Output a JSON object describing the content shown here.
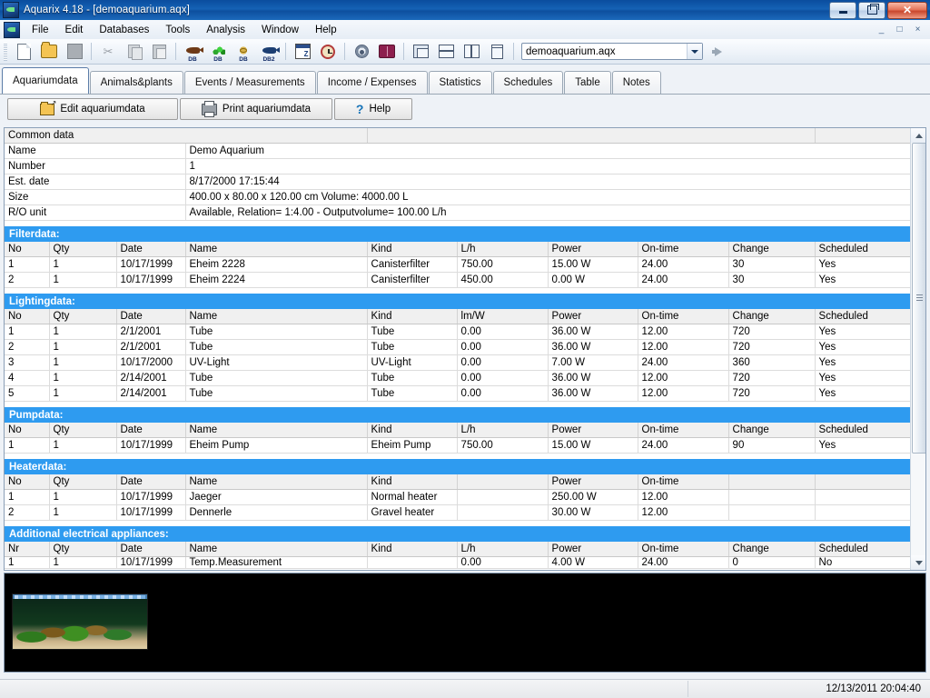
{
  "window": {
    "title": "Aquarix 4.18  - [demoaquarium.aqx]",
    "app_icon": "aquarium-fish-icon",
    "minimize_label": "Minimize",
    "restore_label": "Restore",
    "close_label": "Close",
    "mdi_minimize": "_",
    "mdi_restore": "□",
    "mdi_close": "×"
  },
  "menu": {
    "items": [
      {
        "label": "File"
      },
      {
        "label": "Edit"
      },
      {
        "label": "Databases"
      },
      {
        "label": "Tools"
      },
      {
        "label": "Analysis"
      },
      {
        "label": "Window"
      },
      {
        "label": "Help"
      }
    ]
  },
  "toolbar": {
    "buttons": [
      {
        "icon": "new-document-icon",
        "label": ""
      },
      {
        "icon": "open-folder-icon",
        "label": ""
      },
      {
        "icon": "save-icon",
        "label": ""
      },
      {
        "icon": "cut-scissors-icon",
        "label": ""
      },
      {
        "icon": "copy-icon",
        "label": ""
      },
      {
        "icon": "paste-icon",
        "label": ""
      },
      {
        "icon": "fish-database-icon",
        "label": "DB"
      },
      {
        "icon": "plant-database-icon",
        "label": "DB"
      },
      {
        "icon": "invertebrate-database-icon",
        "label": "DB"
      },
      {
        "icon": "fish-database2-icon",
        "label": "DB2"
      },
      {
        "icon": "calendar-icon",
        "label": ""
      },
      {
        "icon": "alarm-clock-icon",
        "label": ""
      },
      {
        "icon": "settings-gear-icon",
        "label": ""
      },
      {
        "icon": "book-icon",
        "label": ""
      },
      {
        "icon": "cascade-windows-icon",
        "label": ""
      },
      {
        "icon": "tile-horizontal-icon",
        "label": ""
      },
      {
        "icon": "tile-vertical-icon",
        "label": ""
      },
      {
        "icon": "arrange-icons-icon",
        "label": ""
      }
    ],
    "file_combo": {
      "value": "demoaquarium.aqx",
      "placeholder": "demoaquarium.aqx"
    },
    "go_icon": "go-arrow-icon"
  },
  "tabs": [
    {
      "label": "Aquariumdata",
      "active": true
    },
    {
      "label": "Animals&plants",
      "active": false
    },
    {
      "label": "Events / Measurements",
      "active": false
    },
    {
      "label": "Income / Expenses",
      "active": false
    },
    {
      "label": "Statistics",
      "active": false
    },
    {
      "label": "Schedules",
      "active": false
    },
    {
      "label": "Table",
      "active": false
    },
    {
      "label": "Notes",
      "active": false
    }
  ],
  "actions": [
    {
      "label": "Edit aquariumdata",
      "icon": "edit-folder-icon"
    },
    {
      "label": "Print aquariumdata",
      "icon": "printer-icon"
    },
    {
      "label": "Help",
      "icon": "question-mark-icon"
    }
  ],
  "common_data": {
    "title": "Common data",
    "rows": [
      {
        "label": "Name",
        "value": "Demo Aquarium"
      },
      {
        "label": "Number",
        "value": "1"
      },
      {
        "label": "Est. date",
        "value": "8/17/2000 17:15:44"
      },
      {
        "label": "Size",
        "value": "400.00 x 80.00 x 120.00 cm Volume: 4000.00 L"
      },
      {
        "label": "R/O unit",
        "value": "Available, Relation= 1:4.00 - Outputvolume= 100.00 L/h"
      }
    ]
  },
  "sections": [
    {
      "title": "Filterdata:",
      "headers": [
        "No",
        "Qty",
        "Date",
        "Name",
        "Kind",
        "L/h",
        "Power",
        "On-time",
        "Change",
        "Scheduled"
      ],
      "rows": [
        [
          "1",
          "1",
          "10/17/1999",
          "Eheim 2228",
          "Canisterfilter",
          "750.00",
          "15.00 W",
          "24.00",
          "30",
          "Yes"
        ],
        [
          "2",
          "1",
          "10/17/1999",
          "Eheim 2224",
          "Canisterfilter",
          "450.00",
          "0.00 W",
          "24.00",
          "30",
          "Yes"
        ]
      ]
    },
    {
      "title": "Lightingdata:",
      "headers": [
        "No",
        "Qty",
        "Date",
        "Name",
        "Kind",
        "lm/W",
        "Power",
        "On-time",
        "Change",
        "Scheduled"
      ],
      "rows": [
        [
          "1",
          "1",
          "2/1/2001",
          "Tube",
          "Tube",
          "0.00",
          "36.00 W",
          "12.00",
          "720",
          "Yes"
        ],
        [
          "2",
          "1",
          "2/1/2001",
          "Tube",
          "Tube",
          "0.00",
          "36.00 W",
          "12.00",
          "720",
          "Yes"
        ],
        [
          "3",
          "1",
          "10/17/2000",
          "UV-Light",
          "UV-Light",
          "0.00",
          "7.00 W",
          "24.00",
          "360",
          "Yes"
        ],
        [
          "4",
          "1",
          "2/14/2001",
          "Tube",
          "Tube",
          "0.00",
          "36.00 W",
          "12.00",
          "720",
          "Yes"
        ],
        [
          "5",
          "1",
          "2/14/2001",
          "Tube",
          "Tube",
          "0.00",
          "36.00 W",
          "12.00",
          "720",
          "Yes"
        ]
      ]
    },
    {
      "title": "Pumpdata:",
      "headers": [
        "No",
        "Qty",
        "Date",
        "Name",
        "Kind",
        "L/h",
        "Power",
        "On-time",
        "Change",
        "Scheduled"
      ],
      "rows": [
        [
          "1",
          "1",
          "10/17/1999",
          "Eheim Pump",
          "Eheim Pump",
          "750.00",
          "15.00 W",
          "24.00",
          "90",
          "Yes"
        ]
      ]
    },
    {
      "title": "Heaterdata:",
      "headers": [
        "No",
        "Qty",
        "Date",
        "Name",
        "Kind",
        "",
        "Power",
        "On-time",
        "",
        ""
      ],
      "rows": [
        [
          "1",
          "1",
          "10/17/1999",
          "Jaeger",
          "Normal heater",
          "",
          "250.00 W",
          "12.00",
          "",
          ""
        ],
        [
          "2",
          "1",
          "10/17/1999",
          "Dennerle",
          "Gravel heater",
          "",
          "30.00 W",
          "12.00",
          "",
          ""
        ]
      ]
    },
    {
      "title": "Additional electrical appliances:",
      "headers": [
        "Nr",
        "Qty",
        "Date",
        "Name",
        "Kind",
        "L/h",
        "Power",
        "On-time",
        "Change",
        "Scheduled"
      ],
      "rows": [
        [
          "1",
          "1",
          "10/17/1999",
          "Temp.Measurement",
          "",
          "0.00",
          "4.00 W",
          "24.00",
          "0",
          "No"
        ]
      ]
    }
  ],
  "photo": {
    "alt": "aquarium-photo"
  },
  "statusbar": {
    "left": "",
    "middle": "",
    "datetime": "12/13/2011 20:04:40"
  },
  "colors": {
    "section_header_bg": "#2e9bf0",
    "titlebar_blue": "#1562b5",
    "close_red": "#c8462c"
  }
}
